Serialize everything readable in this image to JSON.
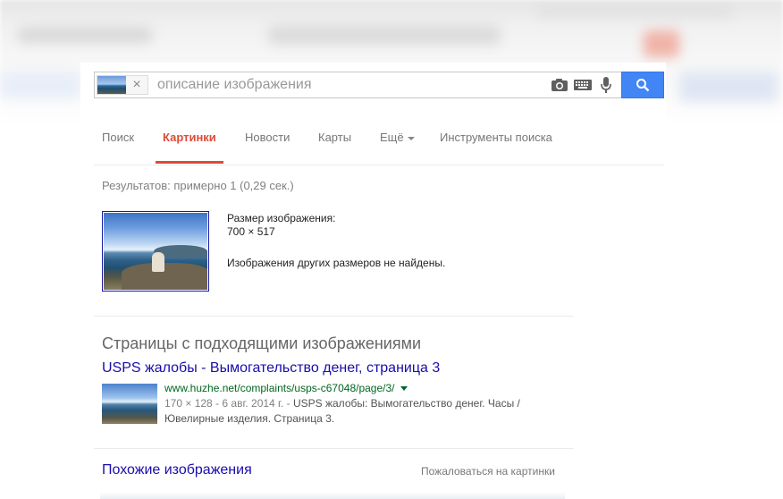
{
  "colors": {
    "accent_red": "#dd4b39",
    "link_blue": "#1a0dab",
    "url_green": "#006621",
    "search_blue": "#4285f4"
  },
  "search": {
    "placeholder": "описание изображения",
    "value": "",
    "camera_icon": "camera-icon",
    "keyboard_icon": "keyboard-icon",
    "mic_icon": "microphone-icon",
    "search_icon": "magnifier-icon",
    "chip_close": "×"
  },
  "tabs": [
    {
      "label": "Поиск",
      "active": false
    },
    {
      "label": "Картинки",
      "active": true
    },
    {
      "label": "Новости",
      "active": false
    },
    {
      "label": "Карты",
      "active": false
    },
    {
      "label": "Ещё",
      "active": false
    },
    {
      "label": "Инструменты поиска",
      "active": false
    }
  ],
  "stats": "Результатов: примерно 1 (0,29 сек.)",
  "image_info": {
    "size_label": "Размер изображения:",
    "size_value": "700 × 517",
    "no_other_sizes": "Изображения других размеров не найдены."
  },
  "matching_pages": {
    "title": "Страницы с подходящими изображениями",
    "results": [
      {
        "title": "USPS жалобы - Вымогательство денег, страница 3",
        "url": "www.huzhe.net/complaints/usps-c67048/page/3/",
        "meta": "170 × 128 - 6 авг. 2014 г. -",
        "snippet": "USPS жалобы: Вымогательство денег. Часы / Ювелирные изделия. Страница 3."
      }
    ]
  },
  "similar_images": "Похожие изображения",
  "report_images": "Пожаловаться на картинки"
}
